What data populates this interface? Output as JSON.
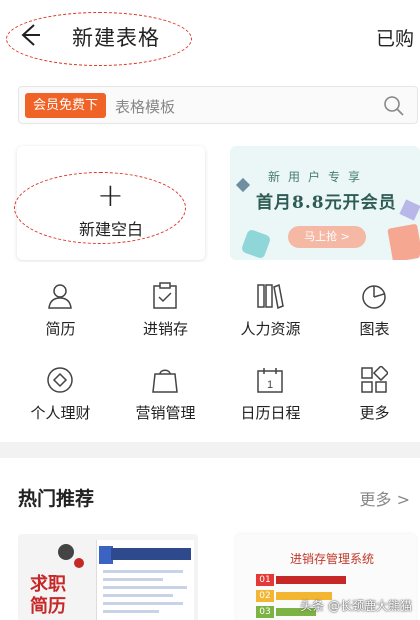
{
  "header": {
    "title": "新建表格",
    "right_label": "已购"
  },
  "search": {
    "vip_tag": "会员免费下",
    "placeholder": "表格模板"
  },
  "new_blank": {
    "plus": "+",
    "label": "新建空白"
  },
  "promo": {
    "subtitle": "新用户专享",
    "headline": "首月8.8元开会员",
    "button": "马上抢 >"
  },
  "grid": [
    {
      "label": "简历",
      "icon": "person-icon"
    },
    {
      "label": "进销存",
      "icon": "clipboard-check-icon"
    },
    {
      "label": "人力资源",
      "icon": "books-icon"
    },
    {
      "label": "图表",
      "icon": "pie-chart-icon"
    },
    {
      "label": "个人理财",
      "icon": "coin-icon"
    },
    {
      "label": "营销管理",
      "icon": "shopping-bag-icon"
    },
    {
      "label": "日历日程",
      "icon": "calendar-icon"
    },
    {
      "label": "更多",
      "icon": "apps-grid-icon"
    }
  ],
  "hot": {
    "title": "热门推荐",
    "more": "更多 >"
  },
  "templates": {
    "resume": {
      "heading": "求职\n简历"
    },
    "inventory": {
      "heading": "进销存管理系统",
      "rows": [
        "01",
        "02",
        "03"
      ]
    }
  },
  "watermark": "头条 @长颈鹿大熊猫",
  "colors": {
    "accent": "#f06327",
    "annotation": "#d32f2f"
  }
}
